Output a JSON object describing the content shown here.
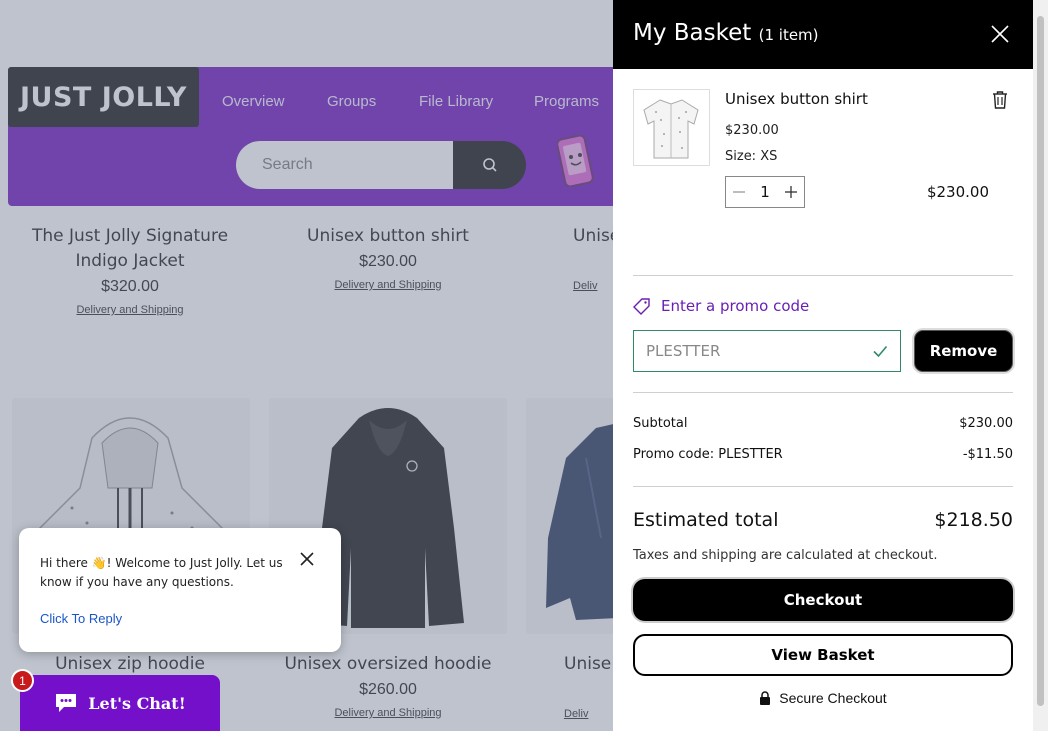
{
  "site": {
    "logo": "JUST JOLLY",
    "nav": [
      "Overview",
      "Groups",
      "File Library",
      "Programs"
    ],
    "search_placeholder": "Search",
    "products_row1": [
      {
        "name": "The Just Jolly Signature Indigo Jacket",
        "price": "$320.00",
        "link": "Delivery and Shipping"
      },
      {
        "name": "Unisex button shirt",
        "price": "$230.00",
        "link": "Delivery and Shipping"
      },
      {
        "name": "Unise",
        "link": "Deliv"
      }
    ],
    "products_row2": [
      {
        "name": "Unisex zip hoodie"
      },
      {
        "name": "Unisex oversized hoodie",
        "price": "$260.00",
        "link": "Delivery and Shipping"
      },
      {
        "name": "Unise",
        "link": "Deliv"
      }
    ]
  },
  "chat": {
    "message": "Hi there 👋! Welcome to Just Jolly. Let us know if you have any questions.",
    "reply": "Click To Reply",
    "button": "Let's Chat!",
    "badge": "1"
  },
  "basket": {
    "title": "My Basket",
    "count": "(1 item)",
    "item": {
      "name": "Unisex button shirt",
      "price": "$230.00",
      "size": "Size: XS",
      "qty": "1",
      "total": "$230.00"
    },
    "promo": {
      "link": "Enter a promo code",
      "value": "PLESTTER",
      "remove": "Remove"
    },
    "summary": {
      "subtotal_label": "Subtotal",
      "subtotal": "$230.00",
      "promo_label": "Promo code: PLESTTER",
      "promo_discount": "-$11.50",
      "estimated_label": "Estimated total",
      "estimated": "$218.50",
      "tax_note": "Taxes and shipping are calculated at checkout."
    },
    "checkout": "Checkout",
    "view_basket": "View Basket",
    "secure": "Secure Checkout"
  },
  "colors": {
    "brand_purple": "#6a0dbd",
    "promo_green": "#2f8a66",
    "promo_link": "#6a1fb4"
  }
}
